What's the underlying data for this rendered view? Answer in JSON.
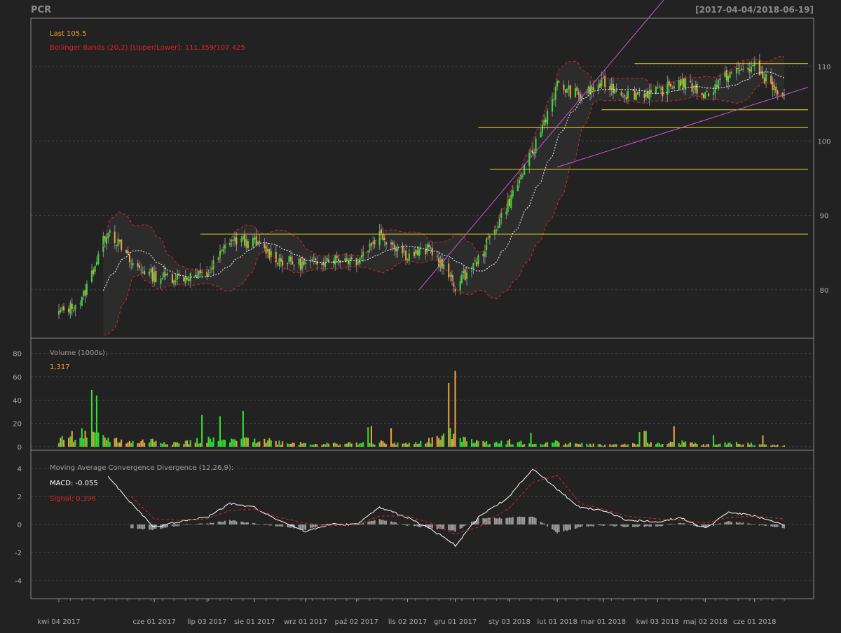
{
  "header": {
    "symbol": "PCR",
    "date_range": "[2017-04-04/2018-06-19]"
  },
  "colors": {
    "background": "#222222",
    "panel_border": "#888888",
    "grid": "#444444",
    "up": "#33dd33",
    "down": "#e8a040",
    "bollinger": "#dd2222",
    "sma": "#ffffff",
    "support_lines": "#e8e020",
    "trend_lines": "#cc55cc",
    "macd": "#ffffff",
    "signal": "#dd2222",
    "histogram": "#999999",
    "label_text": "#aaaaaa",
    "last_text": "#f0a020"
  },
  "price_panel": {
    "last_label": "Last 105.5",
    "bb_label": "Bollinger Bands (20,2) [Upper/Lower]: 111.359/107.425",
    "y_ticks": [
      "80",
      "90",
      "100",
      "110"
    ],
    "y_range": [
      73.5,
      116.5
    ]
  },
  "volume_panel": {
    "title": "Volume (1000s):",
    "last_value": "1,317",
    "y_ticks": [
      "0",
      "20",
      "40",
      "60",
      "80"
    ],
    "y_range": [
      -3,
      93
    ]
  },
  "macd_panel": {
    "title": "Moving Average Convergence Divergence (12,26,9):",
    "macd_label": "MACD: -0.055",
    "signal_label": "Signal: 0.396",
    "y_ticks": [
      "4",
      "2",
      "0",
      "-2",
      "-4"
    ],
    "y_range": [
      -5.3,
      5.3
    ]
  },
  "x_axis": {
    "labels": [
      "kwi 04 2017",
      "cze 01 2017",
      "lip 03 2017",
      "sie 01 2017",
      "wrz 01 2017",
      "paź 02 2017",
      "lis 02 2017",
      "gru 01 2017",
      "sty 03 2018",
      "lut 01 2018",
      "mar 01 2018",
      "kwi 03 2018",
      "maj 02 2018",
      "cze 01 2018"
    ]
  },
  "chart_data": {
    "type": "line",
    "title": "PCR",
    "date_range": "[2017-04-04/2018-06-19]",
    "x": [
      "2017-04-04",
      "2017-04-18",
      "2017-05-04",
      "2017-05-18",
      "2017-06-01",
      "2017-06-16",
      "2017-07-03",
      "2017-07-17",
      "2017-08-01",
      "2017-08-16",
      "2017-09-01",
      "2017-09-15",
      "2017-10-02",
      "2017-10-16",
      "2017-11-02",
      "2017-11-16",
      "2017-12-01",
      "2017-12-15",
      "2018-01-03",
      "2018-01-17",
      "2018-02-01",
      "2018-02-15",
      "2018-03-01",
      "2018-03-15",
      "2018-04-03",
      "2018-04-17",
      "2018-05-02",
      "2018-05-16",
      "2018-06-01",
      "2018-06-19"
    ],
    "series": [
      {
        "name": "Close",
        "values": [
          76.8,
          78.6,
          88.3,
          83.5,
          81.8,
          81.7,
          82.0,
          86.8,
          86.3,
          84.0,
          83.3,
          84.3,
          84.0,
          87.5,
          84.6,
          85.5,
          80.5,
          84.0,
          92.0,
          98.5,
          107.5,
          106.0,
          107.8,
          106.3,
          106.5,
          108.0,
          106.2,
          109.0,
          110.0,
          105.5
        ]
      },
      {
        "name": "Volume (1000s)",
        "values": [
          8,
          15,
          9,
          5,
          7,
          4,
          8,
          6,
          10,
          5,
          4,
          3,
          4,
          5,
          3,
          7,
          17,
          5,
          6,
          3,
          5,
          3,
          2,
          3,
          4,
          5,
          2,
          4,
          3,
          1.317
        ]
      },
      {
        "name": "MACD",
        "values": [
          null,
          null,
          3.4,
          1.5,
          -0.2,
          0.2,
          0.5,
          1.5,
          1.2,
          0.3,
          -0.5,
          0.0,
          0.0,
          1.2,
          0.5,
          -0.3,
          -1.5,
          0.5,
          2.0,
          4.0,
          2.5,
          1.2,
          1.0,
          0.3,
          0.2,
          0.5,
          -0.3,
          0.9,
          0.6,
          -0.055
        ]
      },
      {
        "name": "Signal",
        "values": [
          null,
          null,
          null,
          2.0,
          0.4,
          0.3,
          0.4,
          1.0,
          1.1,
          0.5,
          0.1,
          -0.1,
          0.0,
          0.6,
          0.6,
          0.1,
          -0.7,
          -0.2,
          1.2,
          3.0,
          3.5,
          1.5,
          1.1,
          0.6,
          0.4,
          0.3,
          0.1,
          0.5,
          0.6,
          0.396
        ]
      }
    ],
    "bollinger_last": {
      "upper": 111.359,
      "lower": 107.425
    },
    "annotations": {
      "support_levels": [
        87.5,
        96.2,
        101.8,
        104.2,
        110.4
      ],
      "trend_lines": [
        {
          "from": [
            "2017-11-09",
            80.0
          ],
          "to": [
            "2018-02-01",
            102.0
          ]
        },
        {
          "from": [
            "2018-02-01",
            96.5
          ],
          "to": [
            "2018-06-19",
            106.2
          ]
        }
      ]
    },
    "xlabel": "",
    "ylabel": "",
    "grid": true,
    "legend": "top-left"
  }
}
